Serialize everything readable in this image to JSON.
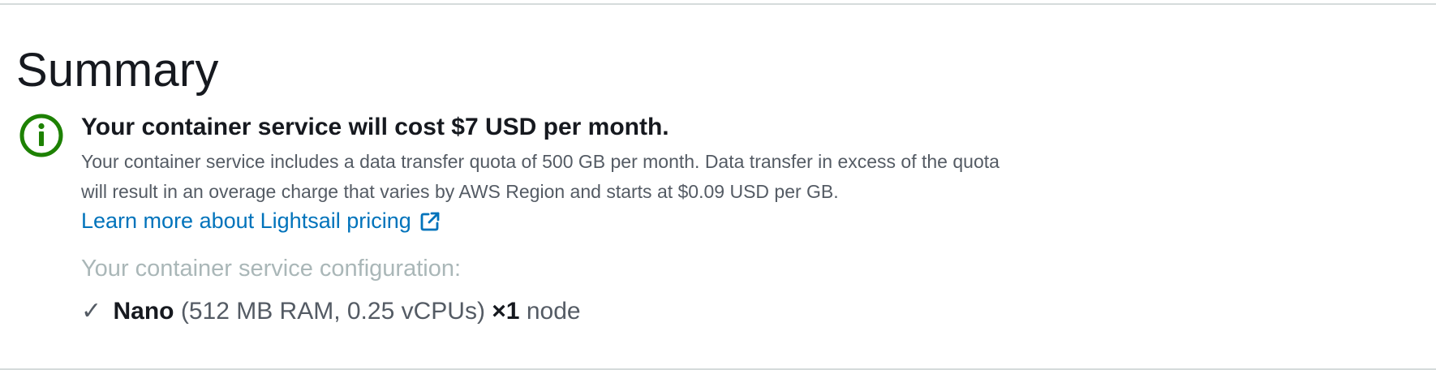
{
  "summary": {
    "title": "Summary",
    "info_icon": "info-circle-icon",
    "info_icon_color": "#1d8102",
    "cost_heading": "Your container service will cost $7 USD per month.",
    "description": "Your container service includes a data transfer quota of 500 GB per month. Data transfer in excess of the quota will result in an overage charge that varies by AWS Region and starts at $0.09 USD per GB.",
    "learn_more_link": "Learn more about Lightsail pricing",
    "learn_more_icon": "external-link-icon",
    "link_color": "#0073bb",
    "config_label": "Your container service configuration:",
    "config": {
      "check_symbol": "✓",
      "plan_name": "Nano",
      "plan_specs": "(512 MB RAM, 0.25 vCPUs)",
      "node_count": "×1",
      "node_unit": "node"
    }
  }
}
